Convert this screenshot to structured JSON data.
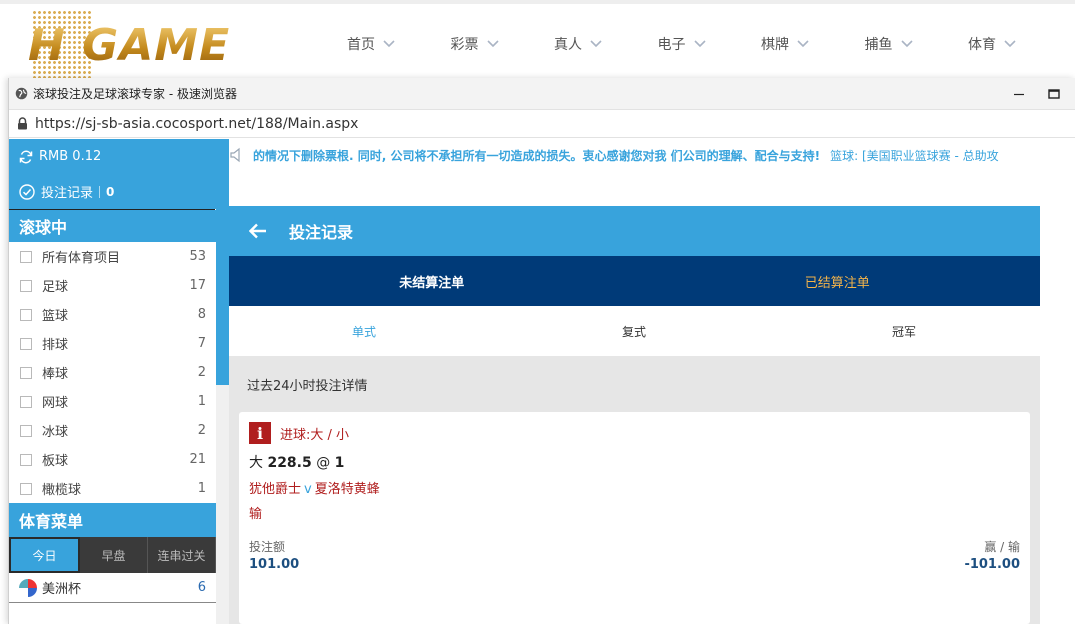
{
  "site": {
    "logo_text": "H GAME",
    "nav": [
      "首页",
      "彩票",
      "真人",
      "电子",
      "棋牌",
      "捕鱼",
      "体育"
    ]
  },
  "browser": {
    "title": "滚球投注及足球滚球专家 - 极速浏览器",
    "url": "https://sj-sb-asia.cocosport.net/188/Main.aspx"
  },
  "sidebar": {
    "balance": "RMB 0.12",
    "bet_record_label": "投注记录",
    "bet_record_count": "0",
    "live_title": "滚球中",
    "sports": [
      {
        "name": "所有体育项目",
        "count": "53"
      },
      {
        "name": "足球",
        "count": "17"
      },
      {
        "name": "篮球",
        "count": "8"
      },
      {
        "name": "排球",
        "count": "7"
      },
      {
        "name": "棒球",
        "count": "2"
      },
      {
        "name": "网球",
        "count": "1"
      },
      {
        "name": "冰球",
        "count": "2"
      },
      {
        "name": "板球",
        "count": "21"
      },
      {
        "name": "橄榄球",
        "count": "1"
      }
    ],
    "menu_title": "体育菜单",
    "menu_tabs": [
      "今日",
      "早盘",
      "连串过关"
    ],
    "league": {
      "name": "美洲杯",
      "count": "6"
    }
  },
  "ticker": {
    "text": "的情况下删除票根. 同时, 公司将不承担所有一切造成的损失。衷心感谢您对我 们公司的理解、配合与支持!",
    "link": "篮球: [美国职业篮球赛 - 总助攻"
  },
  "panel": {
    "title": "投注记录",
    "status_tabs": [
      "未结算注单",
      "已结算注单"
    ],
    "type_tabs": [
      "单式",
      "复式",
      "冠军"
    ],
    "summary": "过去24小时投注详情",
    "bet": {
      "market": "进球:大 / 小",
      "selection": "大",
      "line": "228.5",
      "odds_sep": "@",
      "odds": "1",
      "home": "犹他爵士",
      "vs": "v",
      "away": "夏洛特黄蜂",
      "result": "输",
      "stake_label": "投注额",
      "stake": "101.00",
      "winloss_label": "赢 / 输",
      "winloss": "-101.00"
    }
  },
  "colors": {
    "accent": "#38a3dc",
    "navy": "#003a78",
    "loss_red": "#b01e1e",
    "gold": "#f2b34a"
  }
}
